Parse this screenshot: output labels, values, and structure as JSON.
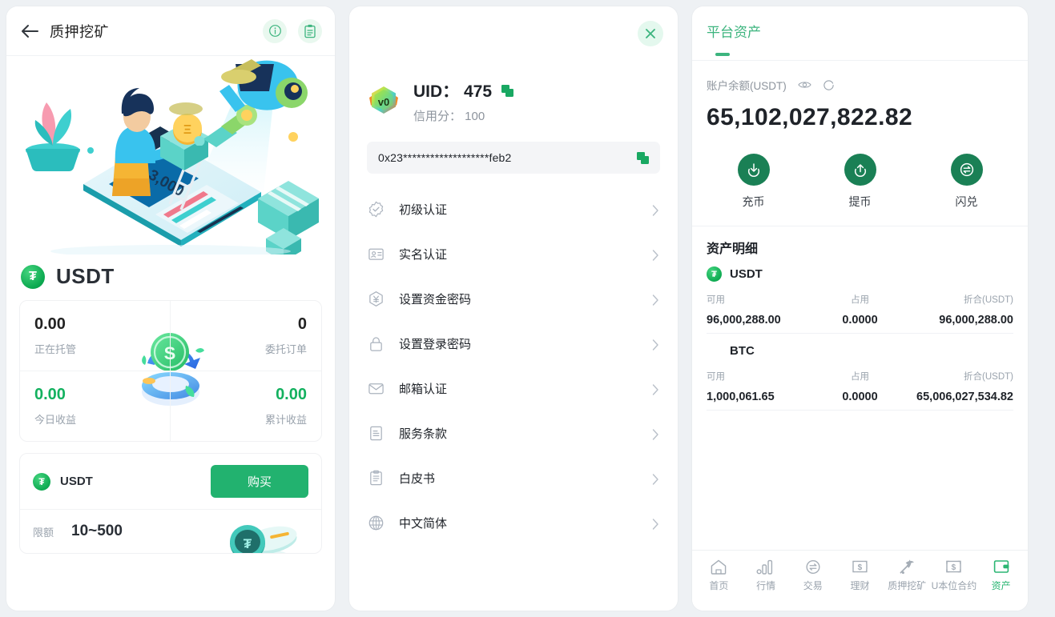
{
  "panel1": {
    "header": {
      "title": "质押挖矿",
      "back_icon": "arrow-left-icon",
      "info_icon": "info-circle-icon",
      "orders_icon": "clipboard-icon"
    },
    "hero_illustration": "stake-mining-illustration",
    "coin": {
      "symbol": "USDT",
      "logo": "usdt-logo"
    },
    "stats": [
      {
        "value": "0.00",
        "label": "正在托管",
        "accent": false,
        "align": "left"
      },
      {
        "value": "0",
        "label": "委托订单",
        "accent": false,
        "align": "right"
      },
      {
        "value": "0.00",
        "label": "今日收益",
        "accent": true,
        "align": "left"
      },
      {
        "value": "0.00",
        "label": "累计收益",
        "accent": true,
        "align": "right"
      }
    ],
    "buy_card": {
      "coin": "USDT",
      "buy_label": "购买",
      "limit_label": "限额",
      "limit_value": "10~500"
    }
  },
  "panel2": {
    "close_icon": "close-icon",
    "vip_badge": "v0",
    "uid_label": "UID：",
    "uid_value": "475",
    "uid_text": "UID： 475",
    "credit_text": "信用分： 100",
    "copy_icon": "copy-icon",
    "wallet_address": "0x23*******************feb2",
    "menu": [
      {
        "label": "初级认证",
        "icon": "badge-check-icon"
      },
      {
        "label": "实名认证",
        "icon": "id-card-icon"
      },
      {
        "label": "设置资金密码",
        "icon": "yen-hexagon-icon"
      },
      {
        "label": "设置登录密码",
        "icon": "lock-icon"
      },
      {
        "label": "邮箱认证",
        "icon": "mail-icon"
      },
      {
        "label": "服务条款",
        "icon": "document-lines-icon"
      },
      {
        "label": "白皮书",
        "icon": "clipboard-list-icon"
      },
      {
        "label": "中文简体",
        "icon": "globe-icon"
      }
    ],
    "chevron_icon": "chevron-right-icon"
  },
  "panel3": {
    "tab": {
      "label": "平台资产",
      "active": true
    },
    "balance": {
      "label": "账户余额(USDT)",
      "eye_icon": "eye-icon",
      "refresh_icon": "refresh-icon",
      "amount": "65,102,027,822.82"
    },
    "actions": [
      {
        "label": "充币",
        "icon": "deposit-icon"
      },
      {
        "label": "提币",
        "icon": "withdraw-icon"
      },
      {
        "label": "闪兑",
        "icon": "swap-icon"
      }
    ],
    "detail_title": "资产明细",
    "columns": {
      "available": "可用",
      "frozen": "占用",
      "converted": "折合(USDT)"
    },
    "assets": [
      {
        "name": "USDT",
        "has_logo": true,
        "available": "96,000,288.00",
        "frozen": "0.0000",
        "converted": "96,000,288.00"
      },
      {
        "name": "BTC",
        "has_logo": false,
        "available": "1,000,061.65",
        "frozen": "0.0000",
        "converted": "65,006,027,534.82"
      }
    ],
    "bottom_nav": [
      {
        "label": "首页",
        "icon": "home-icon",
        "active": false
      },
      {
        "label": "行情",
        "icon": "bar-chart-icon",
        "active": false
      },
      {
        "label": "交易",
        "icon": "swap-circle-icon",
        "active": false
      },
      {
        "label": "理财",
        "icon": "money-icon",
        "active": false
      },
      {
        "label": "质押挖矿",
        "icon": "pickaxe-icon",
        "active": false
      },
      {
        "label": "U本位合约",
        "icon": "contract-icon",
        "active": false
      },
      {
        "label": "资产",
        "icon": "wallet-icon",
        "active": true
      }
    ]
  },
  "colors": {
    "brand_green": "#22b26f",
    "dark_green": "#1a8055",
    "tab_green": "#3cb47e",
    "accent_green": "#13b15f",
    "page_bg": "#eef1f4"
  }
}
